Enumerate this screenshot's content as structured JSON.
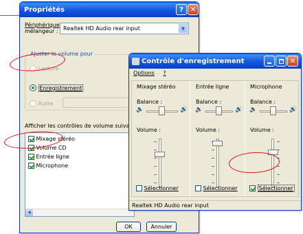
{
  "props_window": {
    "title": "Propriétés",
    "help_btn": "?",
    "close_btn": "✕",
    "device_label_line1": "Périphérique",
    "device_label_line2": "mélangeur :",
    "device_value": "Realtek HD Audio rear input",
    "adjust_group_label": "Ajuster le volume pour",
    "radio_lecture": "Lecture",
    "radio_enregistrement": "Enregistrement",
    "radio_autre": "Autre",
    "show_controls_label": "Afficher les contrôles de volume suivants :",
    "controls": [
      {
        "label": "Mixage stéréo",
        "checked": true
      },
      {
        "label": "Volume CD",
        "checked": true
      },
      {
        "label": "Entrée ligne",
        "checked": true
      },
      {
        "label": "Microphone",
        "checked": true
      }
    ],
    "ok_label": "OK",
    "cancel_label": "Annuler"
  },
  "rec_window": {
    "title": "Contrôle d'enregistrement",
    "menu_options": "Options",
    "menu_help": "?",
    "channels": [
      {
        "name": "Mixage stéréo",
        "balance_label": "Balance :",
        "volume_label": "Volume :",
        "select_label": "Sélectionner",
        "selected": false
      },
      {
        "name": "Entrée ligne",
        "balance_label": "Balance :",
        "volume_label": "Volume :",
        "select_label": "Sélectionner",
        "selected": false
      },
      {
        "name": "Microphone",
        "balance_label": "Balance :",
        "volume_label": "Volume :",
        "select_label": "Sélectionner",
        "selected": true
      }
    ],
    "status_text": "Realtek HD Audio rear input"
  },
  "colors": {
    "annotation": "#e01010",
    "titlebar": "#0a46d0"
  }
}
